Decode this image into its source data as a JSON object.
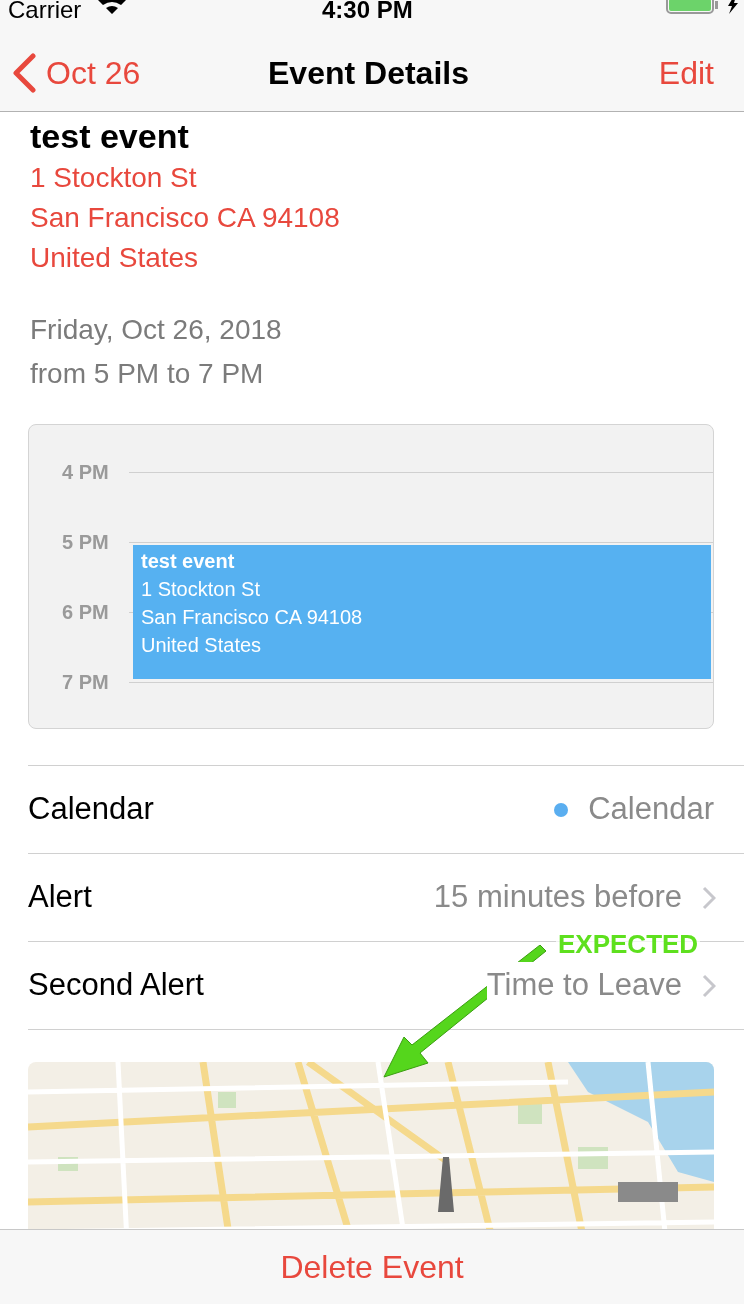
{
  "status_bar": {
    "carrier": "Carrier",
    "time": "4:30 PM"
  },
  "nav": {
    "back": "Oct 26",
    "title": "Event Details",
    "action": "Edit"
  },
  "event": {
    "title": "test event",
    "address": [
      "1 Stockton St",
      "San Francisco CA 94108",
      "United States"
    ],
    "date": "Friday, Oct 26, 2018",
    "time": "from 5 PM to 7 PM"
  },
  "day_view": {
    "hours": [
      "4 PM",
      "5 PM",
      "6 PM",
      "7 PM"
    ],
    "event": {
      "title": "test event",
      "lines": [
        "1 Stockton St",
        "San Francisco CA 94108",
        "United States"
      ]
    }
  },
  "rows": [
    {
      "kind": "calendar",
      "label": "Calendar",
      "value": "Calendar",
      "color": "#5aaef0"
    },
    {
      "kind": "disclosure",
      "label": "Alert",
      "value": "15 minutes before"
    },
    {
      "kind": "disclosure",
      "label": "Second Alert",
      "value": "Time to Leave"
    }
  ],
  "annotation": {
    "text": "EXPECTED"
  },
  "delete_button": "Delete Event"
}
